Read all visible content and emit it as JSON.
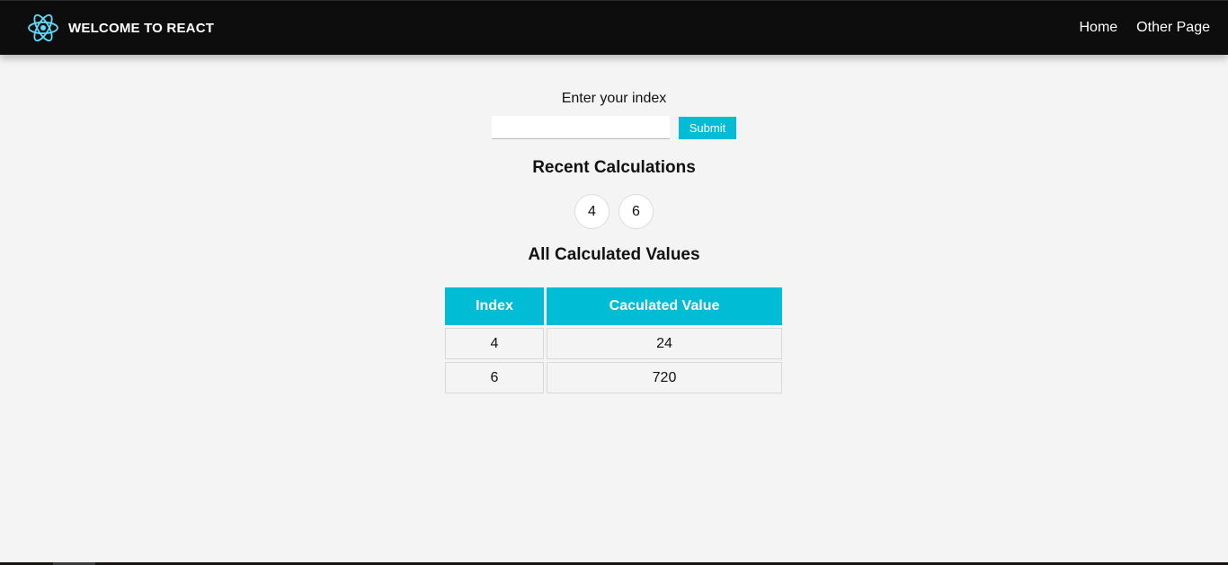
{
  "navbar": {
    "brand": "WELCOME TO REACT",
    "logo_icon": "react-atom-icon",
    "logo_color": "#61dafb",
    "links": [
      {
        "label": "Home"
      },
      {
        "label": "Other Page"
      }
    ]
  },
  "form": {
    "label": "Enter your index",
    "input_value": "",
    "submit_label": "Submit"
  },
  "recent": {
    "title": "Recent Calculations",
    "items": [
      "4",
      "6"
    ]
  },
  "all_values": {
    "title": "All Calculated Values",
    "headers": [
      "Index",
      "Caculated Value"
    ],
    "rows": [
      [
        "4",
        "24"
      ],
      [
        "6",
        "720"
      ]
    ]
  },
  "colors": {
    "accent": "#00bcd4",
    "navbar_bg": "#0d0d0d",
    "page_bg": "#f4f4f4"
  }
}
